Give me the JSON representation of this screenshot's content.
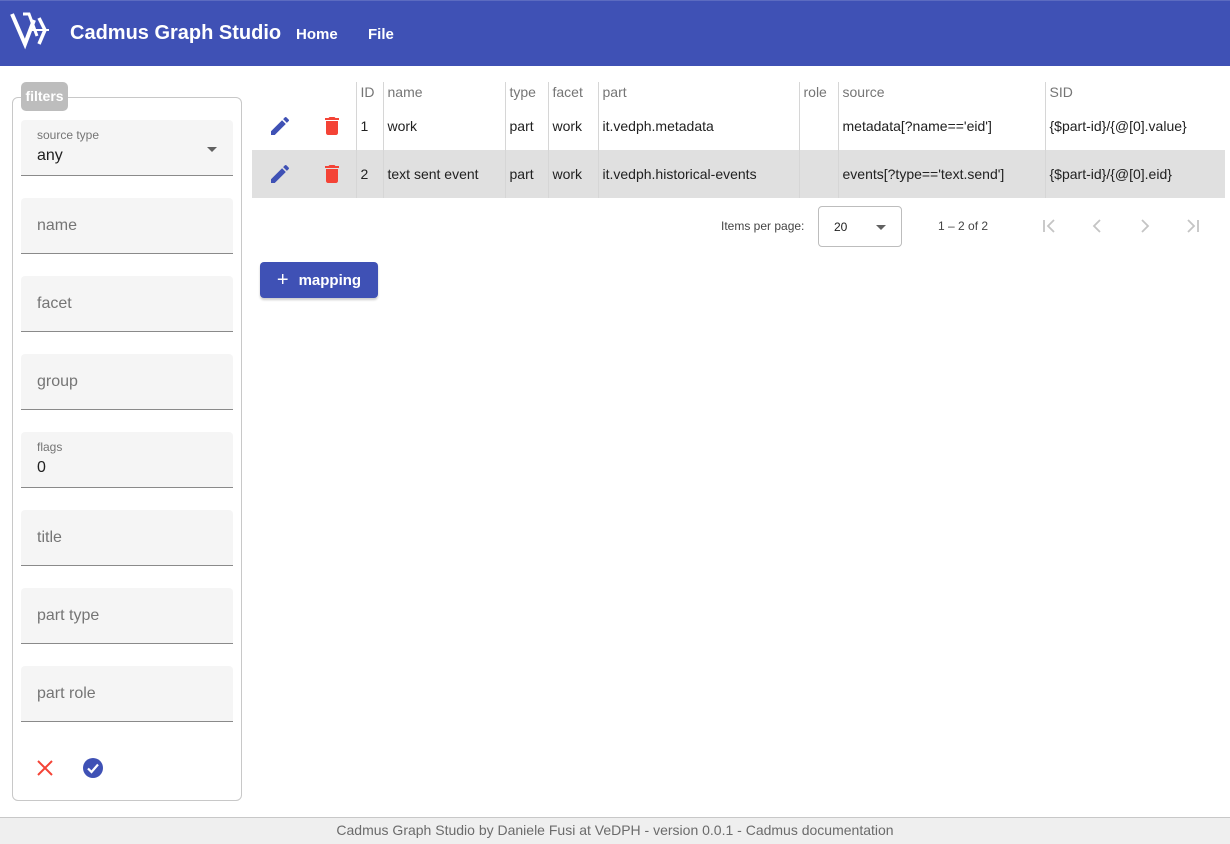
{
  "app": {
    "title": "Cadmus Graph Studio"
  },
  "nav": {
    "home_label": "Home",
    "file_label": "File"
  },
  "colors": {
    "primary": "#3f51b5",
    "warn": "#f44336",
    "toolbar_text": "#ffffff"
  },
  "filters": {
    "legend": "filters",
    "source_type": {
      "label": "source type",
      "value": "any"
    },
    "name": {
      "placeholder": "name"
    },
    "facet": {
      "placeholder": "facet"
    },
    "group": {
      "placeholder": "group"
    },
    "flags": {
      "label": "flags",
      "value": "0"
    },
    "title": {
      "placeholder": "title"
    },
    "part_type": {
      "placeholder": "part type"
    },
    "part_role": {
      "placeholder": "part role"
    },
    "clear_icon": "close-icon",
    "apply_icon": "check-circle-icon"
  },
  "table": {
    "headers": {
      "id": "ID",
      "name": "name",
      "type": "type",
      "facet": "facet",
      "part": "part",
      "role": "role",
      "source": "source",
      "sid": "SID"
    },
    "rows": [
      {
        "id": "1",
        "name": "work",
        "type": "part",
        "facet": "work",
        "part": "it.vedph.metadata",
        "role": "",
        "source": "metadata[?name=='eid']",
        "sid": "{$part-id}/{@[0].value}"
      },
      {
        "id": "2",
        "name": "text sent event",
        "type": "part",
        "facet": "work",
        "part": "it.vedph.historical-events",
        "role": "",
        "source": "events[?type=='text.send']",
        "sid": "{$part-id}/{@[0].eid}"
      }
    ]
  },
  "paginator": {
    "items_per_page_label": "Items per page:",
    "page_size": "20",
    "range": "1 – 2 of 2"
  },
  "actions": {
    "add_mapping_label": "mapping"
  },
  "footer": {
    "text": "Cadmus Graph Studio by Daniele Fusi at VeDPH - version 0.0.1 - Cadmus documentation"
  }
}
